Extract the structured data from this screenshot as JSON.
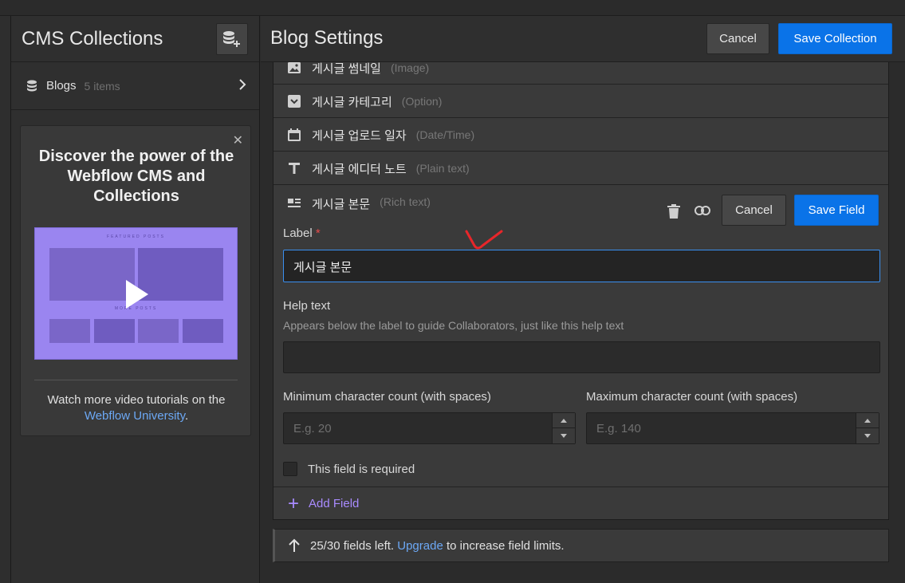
{
  "sidebar": {
    "title": "CMS Collections",
    "add_icon": "add-collection-icon",
    "collection": {
      "label": "Blogs",
      "count": "5 items"
    },
    "promo": {
      "title": "Discover the power of the Webflow CMS and Collections",
      "video_heading": "FEATURED POSTS",
      "video_subheading": "MORE POSTS",
      "body_prefix": "Watch more video tutorials on the",
      "link": "Webflow University",
      "suffix": "."
    }
  },
  "header": {
    "title": "Blog Settings",
    "cancel": "Cancel",
    "save": "Save Collection"
  },
  "fields": [
    {
      "name": "게시글 썸네일",
      "type": "(Image)",
      "icon": "image-icon"
    },
    {
      "name": "게시글 카테고리",
      "type": "(Option)",
      "icon": "option-icon"
    },
    {
      "name": "게시글 업로드 일자",
      "type": "(Date/Time)",
      "icon": "calendar-icon"
    },
    {
      "name": "게시글 에디터 노트",
      "type": "(Plain text)",
      "icon": "text-icon"
    },
    {
      "name": "게시글 본문",
      "type": "(Rich text)",
      "icon": "rich-text-icon"
    }
  ],
  "editor": {
    "cancel": "Cancel",
    "save": "Save Field",
    "label_title": "Label",
    "required_mark": "*",
    "label_value": "게시글 본문",
    "help_title": "Help text",
    "help_hint": "Appears below the label to guide Collaborators, just like this help text",
    "help_value": "",
    "min_title": "Minimum character count (with spaces)",
    "min_placeholder": "E.g. 20",
    "max_title": "Maximum character count (with spaces)",
    "max_placeholder": "E.g. 140",
    "required_label": "This field is required"
  },
  "add_field": "Add Field",
  "notice": {
    "prefix": "25/30 fields left.",
    "link": "Upgrade",
    "suffix": "to increase field limits."
  },
  "colors": {
    "accent_blue": "#0a73e8",
    "add_field_purple": "#a98bff",
    "link_blue": "#6ca8f5",
    "annotation_red": "#e8262a"
  }
}
